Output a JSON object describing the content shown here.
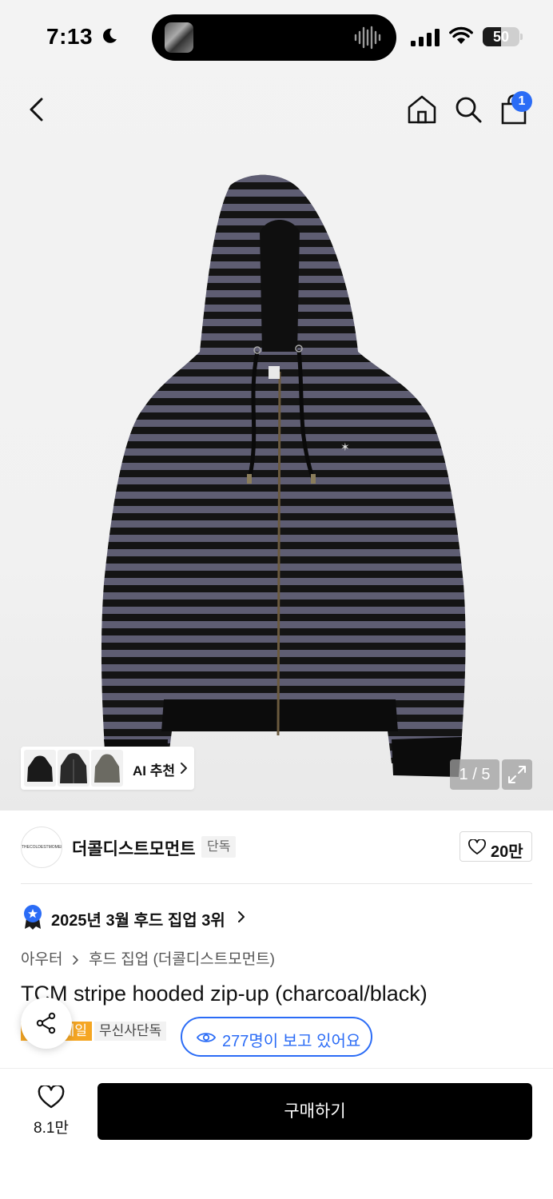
{
  "status_bar": {
    "time": "7:13",
    "battery": "50",
    "battery_level": 0.5
  },
  "nav": {
    "cart_count": "1"
  },
  "gallery": {
    "ai_label": "AI 추천",
    "counter": "1 / 5"
  },
  "brand": {
    "name": "더콜디스트모먼트",
    "tag": "단독",
    "likes": "20만",
    "logo_text": "THECOLDESTMOMENT"
  },
  "ranking": {
    "text": "2025년 3월 후드 집업 3위"
  },
  "breadcrumb": {
    "level1": "아우터",
    "level2": "후드 집업 (더콜디스트모먼트)"
  },
  "product": {
    "title": "TCM stripe hooded zip-up (charcoal/black)",
    "sale_badge": "세일",
    "musinsa_badge": "무신사단독",
    "viewers": "277명이 보고 있어요"
  },
  "bottom": {
    "wish_count": "8.1만",
    "buy_label": "구매하기"
  },
  "colors": {
    "accent_blue": "#2b6cf6",
    "sale_orange": "#f5a623",
    "stripe_dark": "#111111",
    "stripe_light": "#5e5d72"
  },
  "icons": [
    "moon-icon",
    "signal-icon",
    "wifi-icon",
    "battery-icon",
    "back-icon",
    "home-icon",
    "search-icon",
    "cart-icon",
    "chevron-right-icon",
    "expand-icon",
    "heart-icon",
    "rank-badge-icon",
    "eye-icon",
    "share-icon"
  ]
}
